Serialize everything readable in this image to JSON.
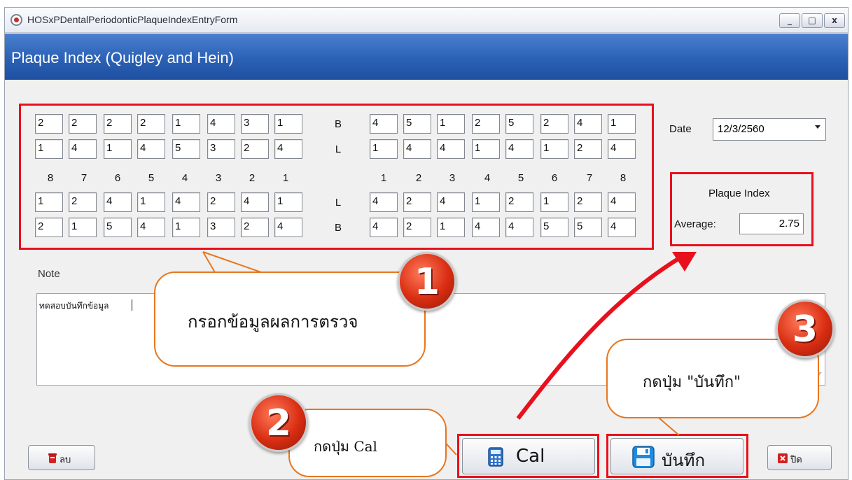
{
  "window": {
    "title": "HOSxPDentalPeriodonticPlaqueIndexEntryForm",
    "controls": {
      "minimize": "_",
      "maximize": "□",
      "close": "x"
    }
  },
  "header": {
    "title": "Plaque Index (Quigley and Hein)"
  },
  "grid": {
    "upper_left": {
      "B": [
        "2",
        "2",
        "2",
        "2",
        "1",
        "4",
        "3",
        "1"
      ],
      "L": [
        "1",
        "4",
        "1",
        "4",
        "5",
        "3",
        "2",
        "4"
      ]
    },
    "upper_right": {
      "B": [
        "4",
        "5",
        "1",
        "2",
        "5",
        "2",
        "4",
        "1"
      ],
      "L": [
        "1",
        "4",
        "4",
        "1",
        "4",
        "1",
        "2",
        "4"
      ]
    },
    "lower_left": {
      "L": [
        "1",
        "2",
        "4",
        "1",
        "4",
        "2",
        "4",
        "1"
      ],
      "B": [
        "2",
        "1",
        "5",
        "4",
        "1",
        "3",
        "2",
        "4"
      ]
    },
    "lower_right": {
      "L": [
        "4",
        "2",
        "4",
        "1",
        "2",
        "1",
        "2",
        "4"
      ],
      "B": [
        "4",
        "2",
        "1",
        "4",
        "4",
        "5",
        "5",
        "4"
      ]
    },
    "row_labels": {
      "upper_b": "B",
      "upper_l": "L",
      "lower_l": "L",
      "lower_b": "B"
    },
    "tooth_numbers_left": [
      "8",
      "7",
      "6",
      "5",
      "4",
      "3",
      "2",
      "1"
    ],
    "tooth_numbers_right": [
      "1",
      "2",
      "3",
      "4",
      "5",
      "6",
      "7",
      "8"
    ]
  },
  "date": {
    "label": "Date",
    "value": "12/3/2560"
  },
  "plaque_index": {
    "title": "Plaque Index",
    "average_label": "Average:",
    "average_value": "2.75"
  },
  "note": {
    "label": "Note",
    "value": "ทดสอบบันทึกข้อมูล"
  },
  "buttons": {
    "delete": "ลบ",
    "cal": "Cal",
    "save": "บันทึก",
    "close": "ปิด"
  },
  "callouts": {
    "step1": {
      "number": "1",
      "text": "กรอกข้อมูลผลการตรวจ"
    },
    "step2": {
      "number": "2",
      "text": "กดปุ่ม Cal"
    },
    "step3": {
      "number": "3",
      "text": "กดปุ่ม \"บันทึก\""
    }
  },
  "colors": {
    "highlight": "#e8101c",
    "callout_border": "#e8761e",
    "header_blue": "#2b62b6",
    "badge_red": "#d92d12"
  },
  "icons": {
    "app": "app-icon",
    "delete": "trash-icon",
    "cal": "calculator-icon",
    "save": "floppy-disk-icon",
    "close": "close-x-icon"
  }
}
